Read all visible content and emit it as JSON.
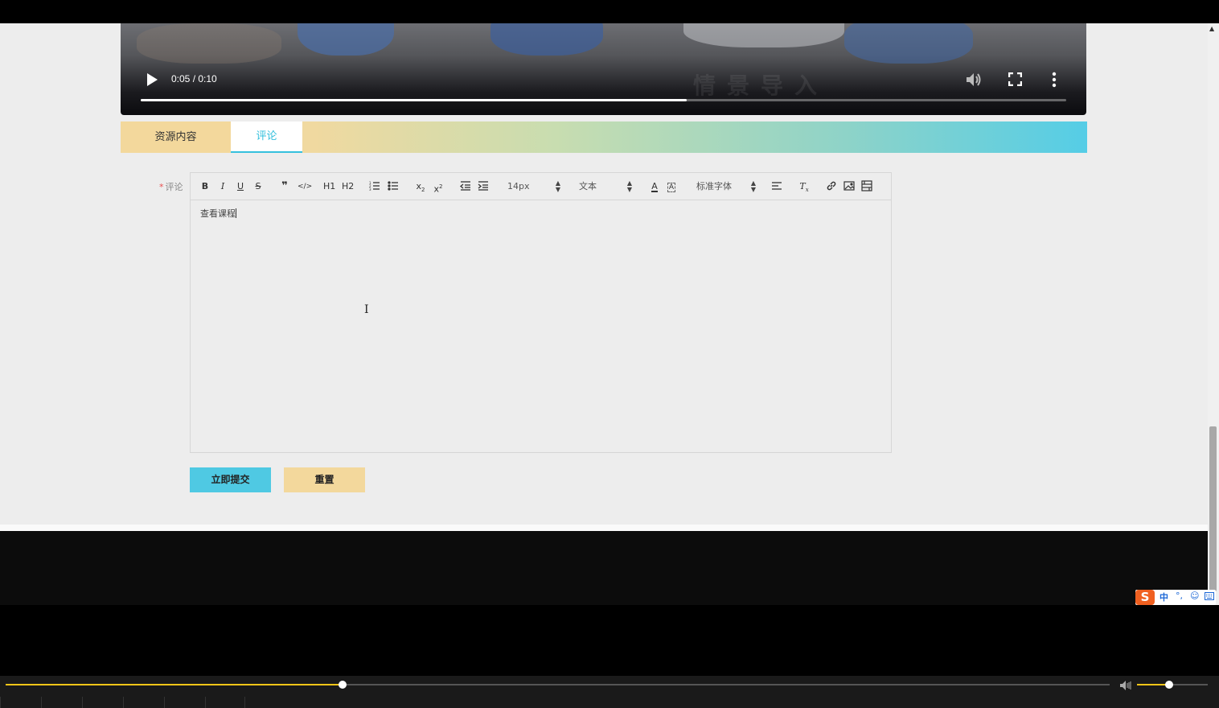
{
  "video": {
    "time": "0:05 / 0:10",
    "progress": 0.59,
    "watermark": "情景导入"
  },
  "tabs": [
    {
      "label": "资源内容",
      "active": false
    },
    {
      "label": "评论",
      "active": true
    }
  ],
  "form": {
    "label": "评论",
    "required_mark": "*",
    "toolbar": {
      "font_size": "14px",
      "heading": "文本",
      "font_family": "标准字体",
      "h1": "H1",
      "h2": "H2"
    },
    "content": "查看课程",
    "submit_label": "立即提交",
    "reset_label": "重置"
  },
  "ime": {
    "mode": "中",
    "punct": "°,",
    "emoji": "☺"
  },
  "player": {
    "progress": 0.305,
    "volume": 0.45
  },
  "colors": {
    "accent": "#35c0dd",
    "submit": "#4fc9e3",
    "reset": "#f3d89c",
    "player_progress": "#f5c518"
  }
}
